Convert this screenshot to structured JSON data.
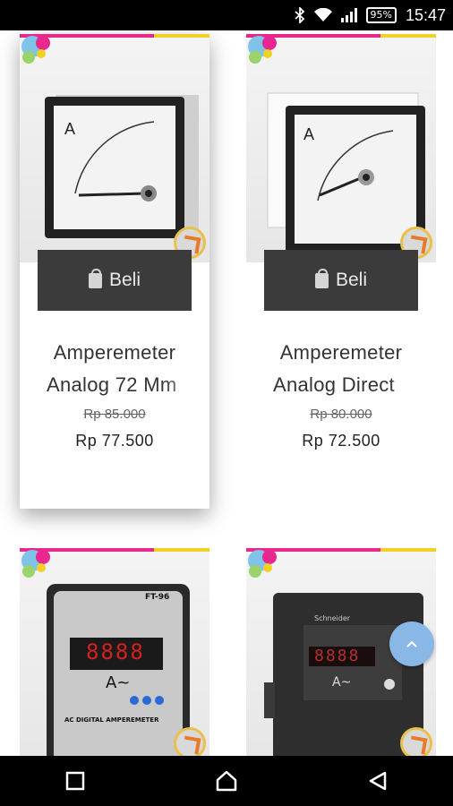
{
  "status_bar": {
    "battery": "95%",
    "time": "15:47",
    "icons": [
      "bluetooth-icon",
      "wifi-icon",
      "signal-icon",
      "battery-icon"
    ]
  },
  "products": [
    {
      "buy_label": "Beli",
      "title_line1": "Amperemeter",
      "title_line2": "Analog 72 Mm",
      "old_price": "Rp 85.000",
      "price": "Rp 77.500",
      "meter": "analog-black-bezel"
    },
    {
      "buy_label": "Beli",
      "title_line1": "Amperemeter",
      "title_line2": "Analog Direct",
      "old_price": "Rp 80.000",
      "price": "Rp 72.500",
      "meter": "analog-black-bezel"
    },
    {
      "meter": "digital-grey",
      "display_text": "8888",
      "brand_text": "FT-96",
      "footer_text": "AC DIGITAL AMPEREMETER"
    },
    {
      "meter": "digital-black",
      "display_text": "8888",
      "brand_text": "Schneider"
    }
  ],
  "fab": {
    "icon": "chevron-up-icon"
  },
  "nav": {
    "icons": [
      "recent-apps-icon",
      "home-icon",
      "back-icon"
    ]
  },
  "colors": {
    "button": "#3b3b3b",
    "fab": "#8ab8e6",
    "accent_pink": "#e8278f",
    "accent_yellow": "#f2d024"
  }
}
